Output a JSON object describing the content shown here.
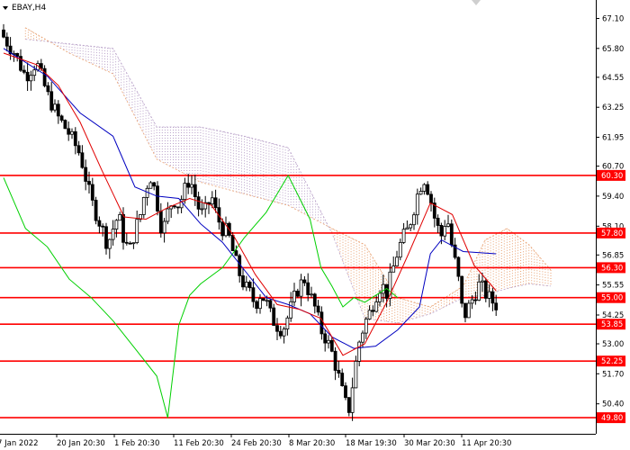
{
  "symbol": "EBAY,H4",
  "colors": {
    "background": "#ffffff",
    "candle": "#000000",
    "level": "#ff0000",
    "tenkan": "#e00000",
    "kijun": "#0000c0",
    "chikou": "#00d000",
    "cloud_bull": "#e8a070",
    "cloud_bear": "#b8a0c8",
    "axis": "#000000"
  },
  "chart_data": {
    "type": "candlestick",
    "instrument": "EBAY",
    "timeframe": "H4",
    "ylim": [
      49.1,
      67.9
    ],
    "y_ticks": [
      "67.10",
      "65.80",
      "64.55",
      "63.25",
      "61.95",
      "60.70",
      "59.40",
      "58.10",
      "56.85",
      "55.55",
      "54.25",
      "53.00",
      "51.70",
      "50.40"
    ],
    "x_ticks": [
      "7 Jan 2022",
      "20 Jan 20:30",
      "1 Feb 20:30",
      "11 Feb 20:30",
      "24 Feb 20:30",
      "8 Mar 20:30",
      "18 Mar 19:30",
      "30 Mar 20:30",
      "11 Apr 20:30"
    ],
    "levels": [
      {
        "label": "60.30",
        "value": 60.3
      },
      {
        "label": "57.80",
        "value": 57.8
      },
      {
        "label": "56.30",
        "value": 56.3
      },
      {
        "label": "55.00",
        "value": 55.0
      },
      {
        "label": "53.85",
        "value": 53.85
      },
      {
        "label": "52.25",
        "value": 52.25
      },
      {
        "label": "49.80",
        "value": 49.8
      }
    ],
    "close_points": [
      [
        0,
        66.3
      ],
      [
        2,
        65.6
      ],
      [
        4,
        64.6
      ],
      [
        6,
        65.2
      ],
      [
        8,
        63.8
      ],
      [
        10,
        62.8
      ],
      [
        12,
        62.1
      ],
      [
        14,
        61.2
      ],
      [
        15,
        60.2
      ],
      [
        16,
        59.2
      ],
      [
        17,
        58.6
      ],
      [
        18,
        58.0
      ],
      [
        19,
        57.3
      ],
      [
        20,
        58.0
      ],
      [
        21,
        58.6
      ],
      [
        22,
        57.5
      ],
      [
        23,
        57.0
      ],
      [
        24,
        57.9
      ],
      [
        25,
        58.6
      ],
      [
        26,
        59.8
      ],
      [
        27,
        60.3
      ],
      [
        28,
        59.2
      ],
      [
        29,
        57.8
      ],
      [
        30,
        58.7
      ],
      [
        31,
        59.3
      ],
      [
        32,
        59.0
      ],
      [
        33,
        59.6
      ],
      [
        34,
        60.2
      ],
      [
        35,
        59.4
      ],
      [
        36,
        58.6
      ],
      [
        37,
        58.8
      ],
      [
        38,
        59.4
      ],
      [
        39,
        58.5
      ],
      [
        40,
        58.0
      ],
      [
        41,
        57.8
      ],
      [
        42,
        56.9
      ],
      [
        43,
        56.1
      ],
      [
        44,
        55.5
      ],
      [
        45,
        55.2
      ],
      [
        46,
        54.7
      ],
      [
        47,
        55.2
      ],
      [
        48,
        54.8
      ],
      [
        49,
        54.1
      ],
      [
        50,
        53.8
      ],
      [
        51,
        53.6
      ],
      [
        52,
        54.2
      ],
      [
        53,
        54.9
      ],
      [
        54,
        55.5
      ],
      [
        55,
        55.8
      ],
      [
        56,
        55.1
      ],
      [
        57,
        54.5
      ],
      [
        58,
        53.6
      ],
      [
        59,
        53.2
      ],
      [
        60,
        52.6
      ],
      [
        61,
        51.8
      ],
      [
        62,
        50.8
      ],
      [
        63,
        50.0
      ],
      [
        64,
        51.6
      ],
      [
        65,
        53.1
      ],
      [
        66,
        53.9
      ],
      [
        67,
        54.4
      ],
      [
        68,
        55.1
      ],
      [
        69,
        55.6
      ],
      [
        70,
        55.2
      ],
      [
        71,
        56.1
      ],
      [
        72,
        57.0
      ],
      [
        73,
        57.6
      ],
      [
        74,
        58.0
      ],
      [
        75,
        58.9
      ],
      [
        76,
        59.8
      ],
      [
        77,
        60.2
      ],
      [
        78,
        59.3
      ],
      [
        79,
        58.2
      ],
      [
        80,
        57.7
      ],
      [
        81,
        58.6
      ],
      [
        82,
        57.1
      ],
      [
        83,
        56.0
      ],
      [
        84,
        54.1
      ],
      [
        85,
        54.6
      ],
      [
        86,
        55.1
      ],
      [
        87,
        55.6
      ],
      [
        88,
        55.2
      ],
      [
        89,
        54.9
      ],
      [
        90,
        54.7
      ]
    ],
    "tenkan_sen": [
      [
        0,
        65.6
      ],
      [
        6,
        65.1
      ],
      [
        10,
        64.2
      ],
      [
        14,
        62.6
      ],
      [
        18,
        60.5
      ],
      [
        22,
        58.5
      ],
      [
        26,
        58.4
      ],
      [
        30,
        58.9
      ],
      [
        34,
        59.3
      ],
      [
        38,
        59.0
      ],
      [
        42,
        57.7
      ],
      [
        46,
        56.0
      ],
      [
        50,
        54.7
      ],
      [
        54,
        54.5
      ],
      [
        58,
        54.1
      ],
      [
        62,
        52.5
      ],
      [
        66,
        53.0
      ],
      [
        70,
        54.8
      ],
      [
        74,
        56.9
      ],
      [
        78,
        59.1
      ],
      [
        82,
        58.6
      ],
      [
        86,
        56.4
      ],
      [
        90,
        55.3
      ]
    ],
    "kijun_sen": [
      [
        0,
        65.8
      ],
      [
        8,
        64.6
      ],
      [
        14,
        63.0
      ],
      [
        20,
        62.0
      ],
      [
        24,
        59.8
      ],
      [
        28,
        59.4
      ],
      [
        32,
        59.3
      ],
      [
        36,
        58.2
      ],
      [
        40,
        57.4
      ],
      [
        44,
        56.2
      ],
      [
        48,
        55.0
      ],
      [
        52,
        54.7
      ],
      [
        56,
        54.3
      ],
      [
        60,
        53.3
      ],
      [
        64,
        52.8
      ],
      [
        68,
        52.9
      ],
      [
        72,
        53.6
      ],
      [
        76,
        54.6
      ],
      [
        78,
        56.9
      ],
      [
        80,
        57.5
      ],
      [
        84,
        57.0
      ],
      [
        90,
        56.9
      ]
    ],
    "chikou_span": [
      [
        0,
        60.2
      ],
      [
        4,
        58.0
      ],
      [
        8,
        57.2
      ],
      [
        12,
        55.8
      ],
      [
        16,
        55.0
      ],
      [
        20,
        54.0
      ],
      [
        24,
        52.8
      ],
      [
        28,
        51.6
      ],
      [
        30,
        49.8
      ],
      [
        32,
        53.8
      ],
      [
        34,
        55.1
      ],
      [
        36,
        55.6
      ],
      [
        40,
        56.3
      ],
      [
        44,
        57.6
      ],
      [
        48,
        58.7
      ],
      [
        52,
        60.3
      ],
      [
        56,
        58.4
      ],
      [
        58,
        56.3
      ],
      [
        60,
        55.5
      ],
      [
        62,
        54.6
      ],
      [
        64,
        55.0
      ],
      [
        66,
        54.8
      ],
      [
        68,
        55.1
      ],
      [
        70,
        55.4
      ],
      [
        72,
        55.0
      ]
    ],
    "senkou_span_a": [
      [
        4,
        66.7
      ],
      [
        12,
        65.6
      ],
      [
        20,
        64.7
      ],
      [
        28,
        61.0
      ],
      [
        36,
        60.0
      ],
      [
        44,
        59.5
      ],
      [
        52,
        59.0
      ],
      [
        60,
        58.0
      ],
      [
        66,
        57.3
      ],
      [
        72,
        55.0
      ],
      [
        78,
        54.6
      ],
      [
        84,
        55.5
      ],
      [
        88,
        57.5
      ],
      [
        92,
        58.0
      ],
      [
        96,
        57.3
      ],
      [
        100,
        56.2
      ]
    ],
    "senkou_span_b": [
      [
        4,
        66.2
      ],
      [
        12,
        66.0
      ],
      [
        20,
        65.8
      ],
      [
        28,
        62.4
      ],
      [
        36,
        62.4
      ],
      [
        44,
        62.0
      ],
      [
        52,
        61.5
      ],
      [
        60,
        57.8
      ],
      [
        66,
        54.1
      ],
      [
        72,
        53.9
      ],
      [
        78,
        54.3
      ],
      [
        84,
        55.0
      ],
      [
        88,
        55.1
      ],
      [
        92,
        55.4
      ],
      [
        96,
        55.6
      ],
      [
        100,
        55.5
      ]
    ]
  }
}
